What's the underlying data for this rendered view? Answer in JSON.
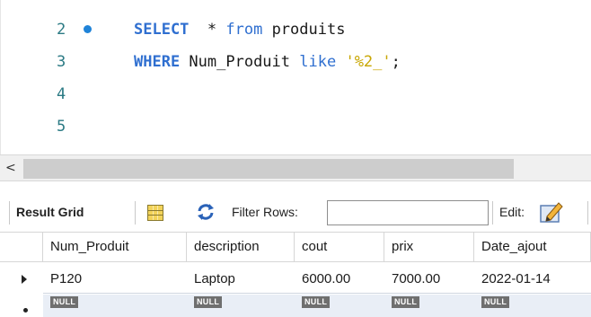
{
  "editor": {
    "lines": [
      {
        "num": "2",
        "has_marker": true,
        "tokens": [
          {
            "text": "SELECT",
            "cls": "kw"
          },
          {
            "text": "  * ",
            "cls": "ident"
          },
          {
            "text": "from",
            "cls": "kw2"
          },
          {
            "text": " produits",
            "cls": "ident"
          }
        ]
      },
      {
        "num": "3",
        "has_marker": false,
        "tokens": [
          {
            "text": "WHERE",
            "cls": "kw"
          },
          {
            "text": " Num_Produit ",
            "cls": "ident"
          },
          {
            "text": "like",
            "cls": "kw2"
          },
          {
            "text": " ",
            "cls": "ident"
          },
          {
            "text": "'%2_'",
            "cls": "str"
          },
          {
            "text": ";",
            "cls": "ident"
          }
        ]
      },
      {
        "num": "4",
        "has_marker": false,
        "tokens": []
      },
      {
        "num": "5",
        "has_marker": false,
        "tokens": []
      }
    ]
  },
  "scrollbar": {
    "left_arrow": "<"
  },
  "toolbar": {
    "result_grid_label": "Result Grid",
    "filter_label": "Filter Rows:",
    "filter_value": "",
    "edit_label": "Edit:"
  },
  "grid": {
    "columns": [
      "Num_Produit",
      "description",
      "cout",
      "prix",
      "Date_ajout"
    ],
    "rows": [
      [
        "P120",
        "Laptop",
        "6000.00",
        "7000.00",
        "2022-01-14"
      ]
    ],
    "new_row": [
      "NULL",
      "NULL",
      "NULL",
      "NULL",
      "NULL"
    ]
  },
  "colors": {
    "keyword": "#2f6fd0",
    "string": "#c8a600",
    "line_number": "#2b7a84",
    "marker_dot": "#1f83d8",
    "null_badge": "#6f6f6f"
  }
}
